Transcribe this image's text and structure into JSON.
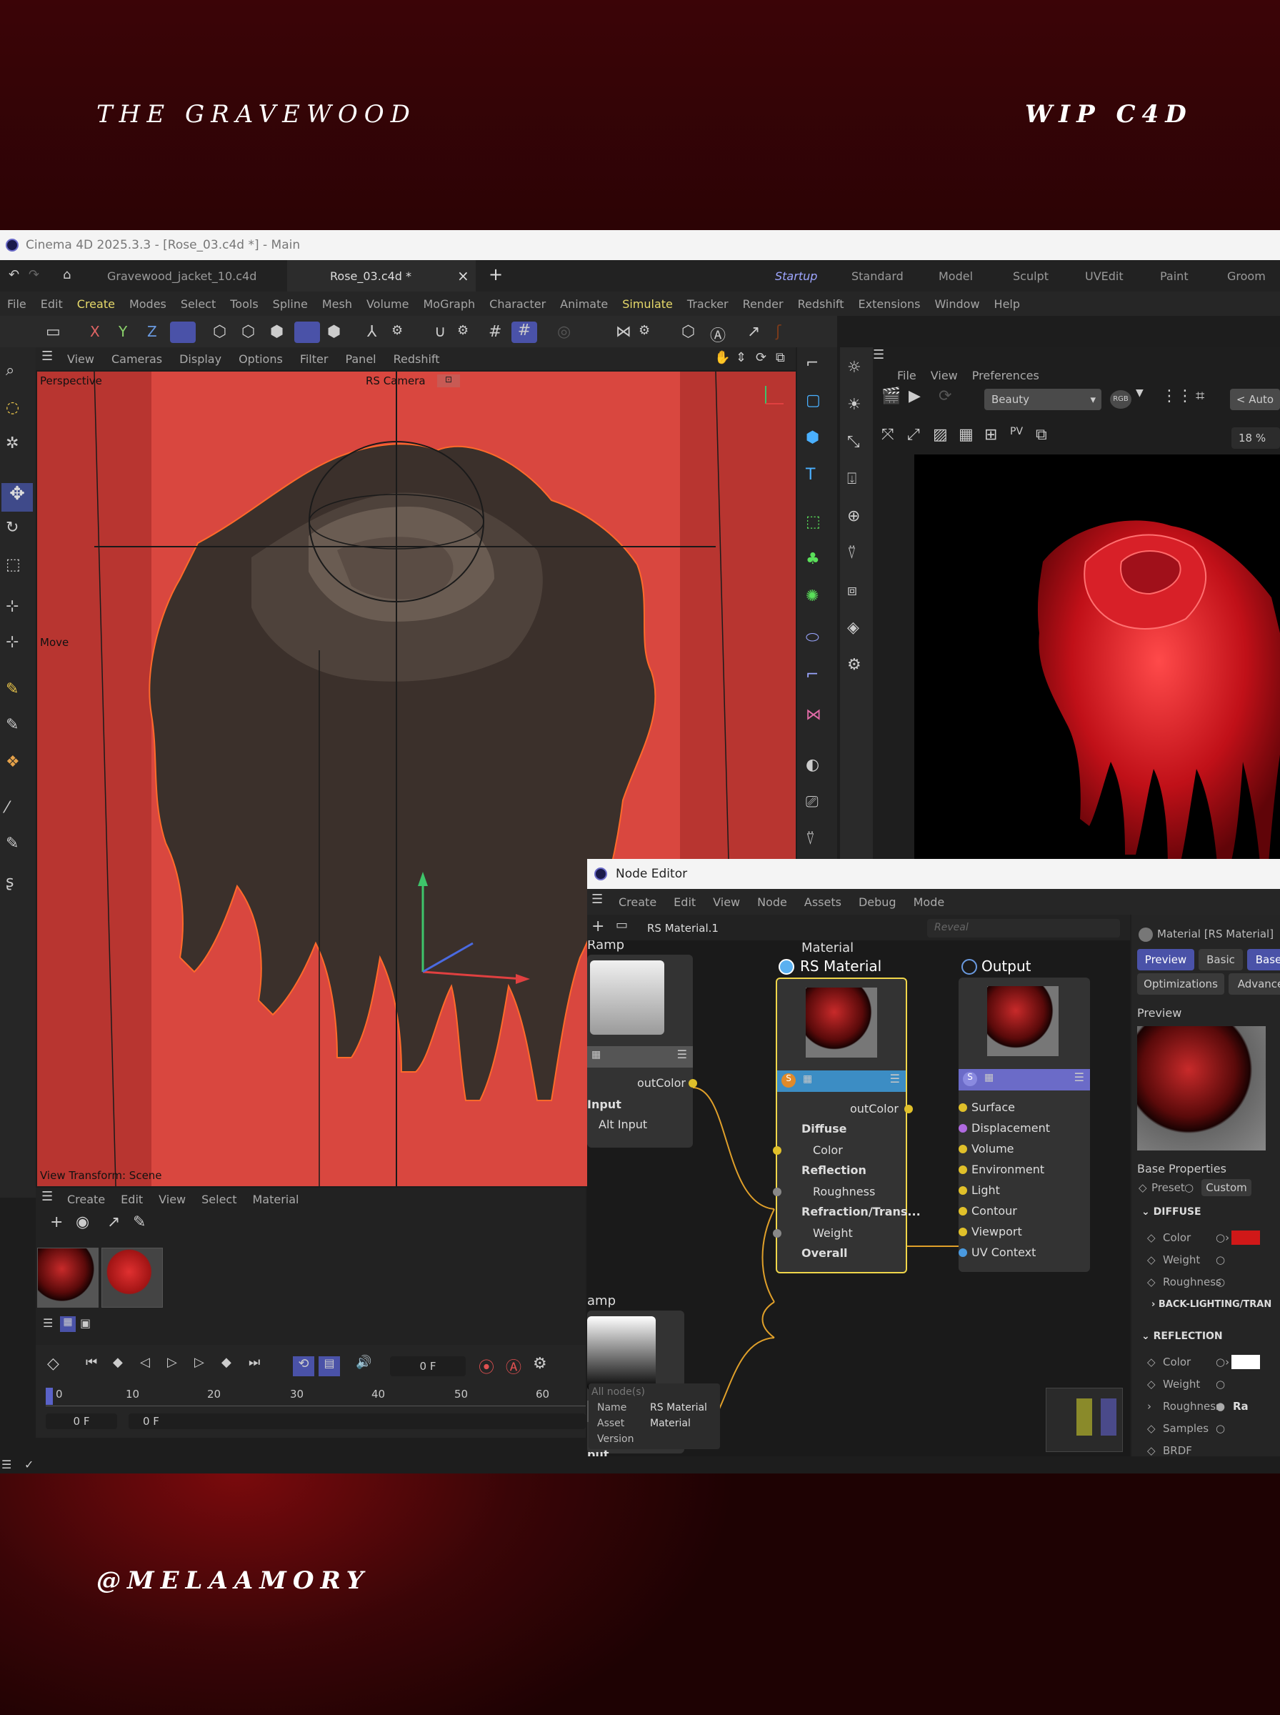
{
  "banner": {
    "left": "THE GRAVEWOOD",
    "right": "WIP C4D",
    "handle": "@MELAAMORY"
  },
  "window": {
    "title": "Cinema 4D 2025.3.3 - [Rose_03.c4d *] - Main"
  },
  "tabs": {
    "file1": "Gravewood_jacket_10.c4d",
    "file2": "Rose_03.c4d *",
    "add": "+",
    "close": "×",
    "layouts": [
      "Startup",
      "Standard",
      "Model",
      "Sculpt",
      "UVEdit",
      "Paint",
      "Groom"
    ]
  },
  "menu": [
    "File",
    "Edit",
    "Create",
    "Modes",
    "Select",
    "Tools",
    "Spline",
    "Mesh",
    "Volume",
    "MoGraph",
    "Character",
    "Animate",
    "Simulate",
    "Tracker",
    "Render",
    "Redshift",
    "Extensions",
    "Window",
    "Help"
  ],
  "axes": {
    "x": "X",
    "y": "Y",
    "z": "Z"
  },
  "viewport": {
    "menu": [
      "View",
      "Cameras",
      "Display",
      "Options",
      "Filter",
      "Panel",
      "Redshift"
    ],
    "label": "Perspective",
    "camera": "RS Camera",
    "tool": "Move",
    "transform": "View Transform: Scene"
  },
  "rv": {
    "menu": [
      "File",
      "View",
      "Preferences"
    ],
    "beauty": "Beauty",
    "rgb": "RGB",
    "auto": "< Auto",
    "zoom": "18 %"
  },
  "matmgr": {
    "menu": [
      "Create",
      "Edit",
      "View",
      "Select",
      "Material"
    ]
  },
  "timeline": {
    "frame": "0 F",
    "ticks": [
      "0",
      "10",
      "20",
      "30",
      "40",
      "50",
      "60"
    ],
    "start": "0 F",
    "end": "0 F"
  },
  "nodeeditor": {
    "title": "Node Editor",
    "menu": [
      "Create",
      "Edit",
      "View",
      "Node",
      "Assets",
      "Debug",
      "Mode"
    ],
    "path": "RS Material.1",
    "search": "Reveal",
    "ramp1": {
      "title": "Ramp",
      "out": "outColor",
      "in_header": "Input",
      "in": "Alt Input"
    },
    "ramp2": {
      "title": "amp",
      "out": "outColor",
      "in_header": "put"
    },
    "material": {
      "sub": "Material",
      "title": "RS Material",
      "out": "outColor",
      "rows": [
        "Diffuse",
        "Color",
        "Reflection",
        "Roughness",
        "Refraction/Trans...",
        "Weight",
        "Overall"
      ]
    },
    "output": {
      "title": "Output",
      "rows": [
        "Surface",
        "Displacement",
        "Volume",
        "Environment",
        "Light",
        "Contour",
        "Viewport",
        "UV Context"
      ]
    },
    "tooltip": {
      "header": "All node(s)",
      "k1": "Name",
      "v1": "RS Material",
      "k2": "Asset",
      "v2": "Material",
      "k3": "Version"
    }
  },
  "attr": {
    "title": "Material [RS Material]",
    "tabs": [
      "Preview",
      "Basic",
      "Base"
    ],
    "tabs2": [
      "Optimizations",
      "Advance"
    ],
    "preview": "Preview",
    "baseprops": "Base Properties",
    "preset": "Preset",
    "custom": "Custom",
    "diffuse": "DIFFUSE",
    "d_rows": [
      "Color",
      "Weight",
      "Roughness"
    ],
    "back": "BACK-LIGHTING/TRAN",
    "reflection": "REFLECTION",
    "r_rows": [
      "Color",
      "Weight",
      "Roughness",
      "Samples",
      "BRDF"
    ],
    "ra": "Ra"
  },
  "colors": {
    "accent": "#f0d64a",
    "viewport_bg": "#d9473f",
    "header_blue": "#3c8dc4",
    "header_purple": "#6b6bc8"
  }
}
